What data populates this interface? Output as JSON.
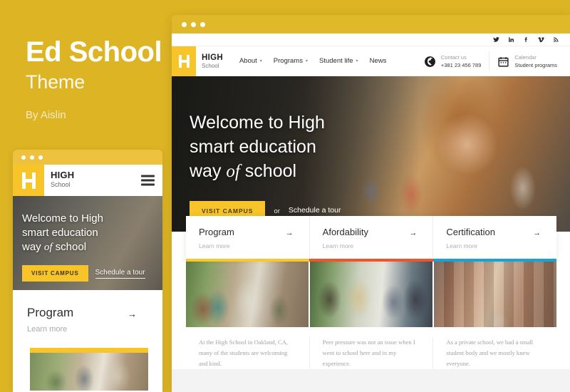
{
  "promo": {
    "title": "Ed School",
    "subtitle": "Theme",
    "author": "By Aislin"
  },
  "brand": {
    "name": "HIGH",
    "sub": "School",
    "logo_icon": "h-monogram-icon",
    "accent_yellow": "#f7c42a",
    "page_background": "#ddb424"
  },
  "topbar": {
    "social": [
      {
        "name": "twitter-icon",
        "glyph": "t"
      },
      {
        "name": "linkedin-icon",
        "glyph": "in"
      },
      {
        "name": "facebook-icon",
        "glyph": "f"
      },
      {
        "name": "vimeo-icon",
        "glyph": "V"
      },
      {
        "name": "rss-icon",
        "glyph": "r"
      }
    ]
  },
  "nav": {
    "items": [
      {
        "label": "About",
        "has_dropdown": true
      },
      {
        "label": "Programs",
        "has_dropdown": true
      },
      {
        "label": "Student life",
        "has_dropdown": true
      },
      {
        "label": "News",
        "has_dropdown": false
      }
    ],
    "caret": "▾",
    "burger_icon": "hamburger-menu-icon"
  },
  "contacts": [
    {
      "icon": "globe-icon",
      "label": "Contact us",
      "value": "+381 23 456 789"
    },
    {
      "icon": "calendar-icon",
      "label": "Calendar",
      "value": "Student programs"
    }
  ],
  "hero": {
    "line1": "Welcome to High",
    "line2": "smart education",
    "line3_a": "way ",
    "line3_italic": "of",
    "line3_b": " school",
    "primary_button": "VISIT CAMPUS",
    "or": "or",
    "secondary_link": "Schedule a tour"
  },
  "cards": [
    {
      "title": "Program",
      "sub": "Learn more",
      "arrow": "→",
      "color": "#fbc72b"
    },
    {
      "title": "Afordability",
      "sub": "Learn more",
      "arrow": "→",
      "color": "#f0542a"
    },
    {
      "title": "Certification",
      "sub": "Learn more",
      "arrow": "→",
      "color": "#13a4dc"
    }
  ],
  "photos": [
    {
      "name": "students-with-laptops-photo"
    },
    {
      "name": "students-studying-group-photo"
    },
    {
      "name": "campus-courtyard-arches-photo"
    }
  ],
  "quotes": [
    "At the High School in Oakland, CA, many of the students are welcoming and kind.",
    "Peer pressure was not an issue when I went to school here and in my experience.",
    "As a private school, we had a small student body and we mostly knew everyone."
  ]
}
